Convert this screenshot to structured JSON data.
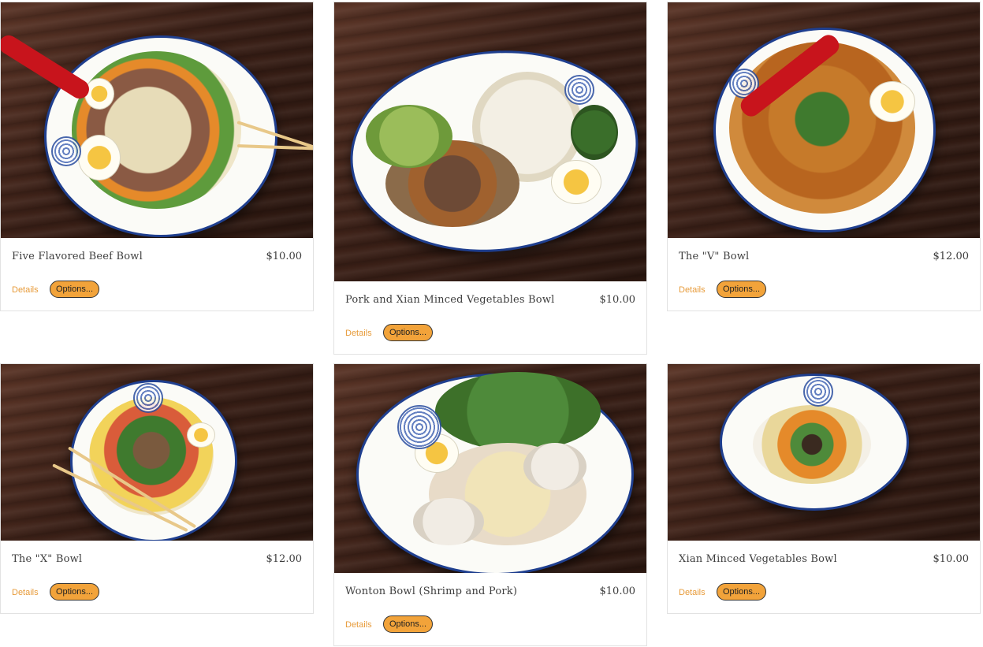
{
  "menu": {
    "details_label": "Details",
    "options_label": "Options...",
    "items": [
      {
        "title": "Five Flavored Beef Bowl",
        "price": "$10.00"
      },
      {
        "title": "Pork and Xian Minced Vegetables Bowl",
        "price": "$10.00"
      },
      {
        "title": "The \"V\" Bowl",
        "price": "$12.00"
      },
      {
        "title": "The \"X\" Bowl",
        "price": "$12.00"
      },
      {
        "title": "Wonton Bowl (Shrimp and Pork)",
        "price": "$10.00"
      },
      {
        "title": "Xian Minced Vegetables Bowl",
        "price": "$10.00"
      }
    ]
  }
}
